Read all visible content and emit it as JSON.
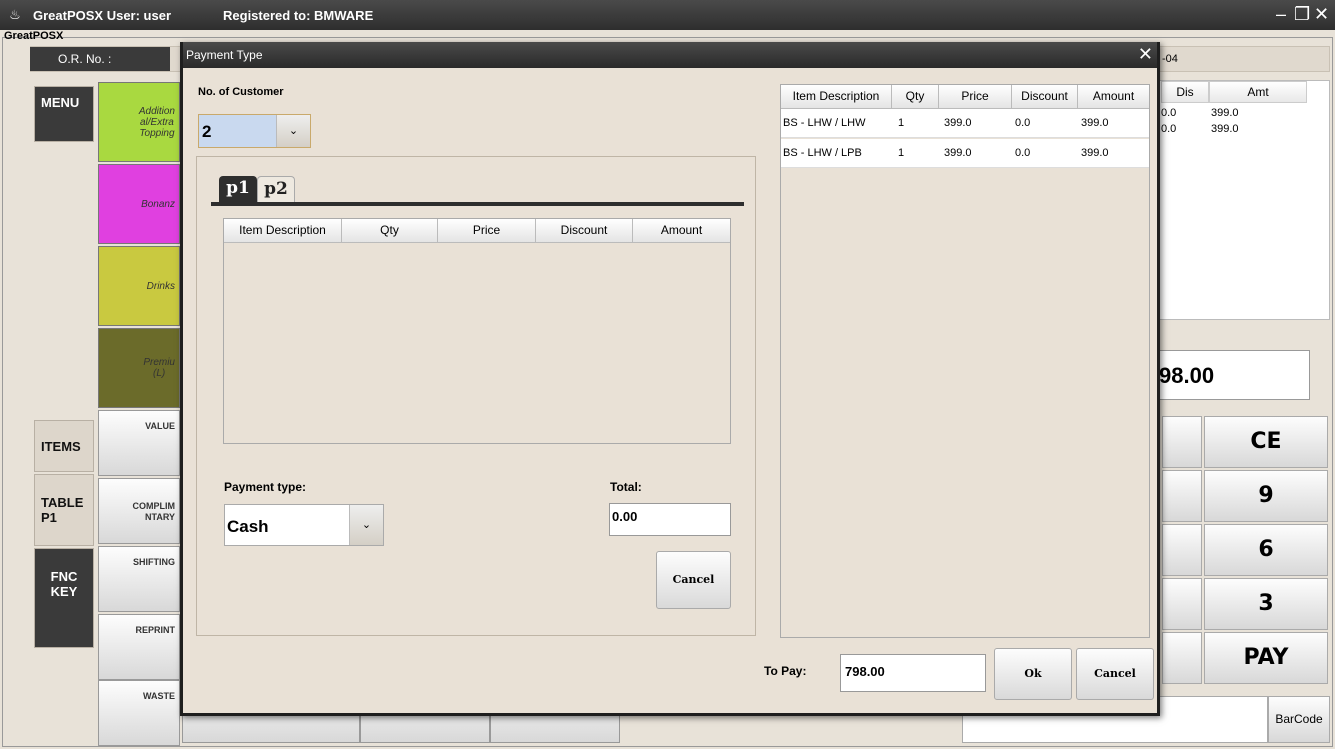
{
  "window": {
    "title": "GreatPOSX  User: user",
    "registered": "Registered to:  BMWARE",
    "group_label": "GreatPOSX"
  },
  "background": {
    "or_label": "O.R. No. :",
    "date_fragment": "-04",
    "side_tabs": [
      "MENU",
      "ITEMS",
      "TABLE\nP1",
      "FNC\nKEY"
    ],
    "categories": [
      {
        "label": "Addition\nal/Extra\nTopping",
        "color": "#a9d940"
      },
      {
        "label": "Bonanz",
        "color": "#e040e0"
      },
      {
        "label": "Drinks",
        "color": "#c9c940"
      },
      {
        "label": "Premiu\n(L)",
        "color": "#6b6b2a"
      }
    ],
    "function_buttons": [
      "VALUE",
      "COMPLIM\nNTARY",
      "SHIFTING",
      "REPRINT",
      "WASTE"
    ],
    "order_list": {
      "headers": [
        "Dis",
        "Amt"
      ],
      "rows": [
        [
          "0.0",
          "399.0"
        ],
        [
          "0.0",
          "399.0"
        ]
      ]
    },
    "total": "98.00",
    "keys": [
      "CE",
      "9",
      "6",
      "3",
      "PAY"
    ],
    "barcode_button": "BarCode"
  },
  "modal": {
    "title": "Payment Type",
    "customers_label": "No. of Customer",
    "customers_value": "2",
    "tabs": [
      "p1",
      "p2"
    ],
    "columns": [
      "Item Description",
      "Qty",
      "Price",
      "Discount",
      "Amount"
    ],
    "payment_type_label": "Payment type:",
    "payment_type_value": "Cash",
    "total_label": "Total:",
    "total_value": "0.00",
    "cancel_label": "Cancel",
    "items": [
      [
        "BS - LHW / LHW",
        "1",
        "399.0",
        "0.0",
        "399.0"
      ],
      [
        "BS - LHW / LPB",
        "1",
        "399.0",
        "0.0",
        "399.0"
      ]
    ],
    "to_pay_label": "To Pay:",
    "to_pay_value": "798.00",
    "ok_label": "Ok",
    "cancel2_label": "Cancel"
  }
}
